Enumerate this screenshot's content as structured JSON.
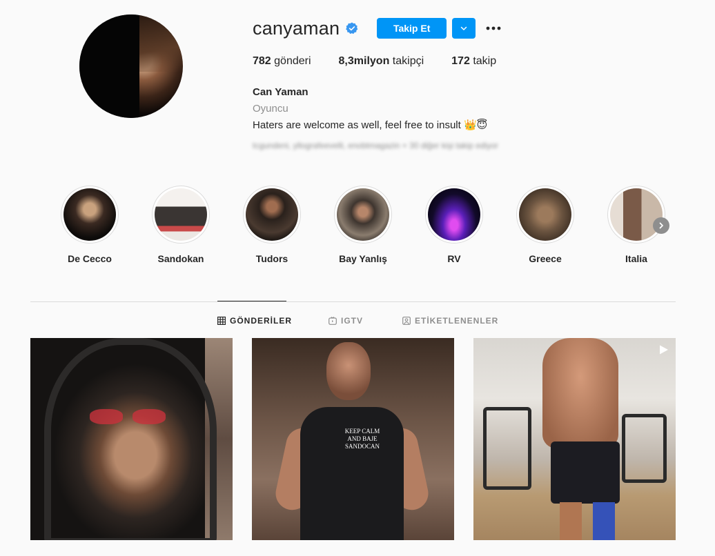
{
  "profile": {
    "username": "canyaman",
    "follow_label": "Takip Et",
    "stats": [
      {
        "value": "782",
        "label": "gönderi"
      },
      {
        "value": "8,3milyon",
        "label": "takipçi"
      },
      {
        "value": "172",
        "label": "takip"
      }
    ],
    "full_name": "Can Yaman",
    "category": "Oyuncu",
    "bio": "Haters are welcome as well, feel free to insult 👑😇",
    "followed_by_blurred": "tcgundeni, yllografeevelli, enobtmagazin + 30 diğer kişi takip ediyor"
  },
  "highlights": [
    {
      "label": "De Cecco"
    },
    {
      "label": "Sandokan"
    },
    {
      "label": "Tudors"
    },
    {
      "label": "Bay Yanlış"
    },
    {
      "label": "RV"
    },
    {
      "label": "Greece"
    },
    {
      "label": "Italia"
    }
  ],
  "tabs": [
    {
      "label": "GÖNDERİLER",
      "icon": "grid-icon",
      "active": true
    },
    {
      "label": "IGTV",
      "icon": "igtv-icon",
      "active": false
    },
    {
      "label": "ETİKETLENENLER",
      "icon": "tagged-icon",
      "active": false
    }
  ],
  "posts": [
    {
      "description": "hooded selfie with red sunglasses"
    },
    {
      "description": "gym photo, shirt text"
    },
    {
      "description": "gym video",
      "is_video": true
    }
  ],
  "post2_shirt_text": "KEEP CALM AND BAJE SANDOCAN",
  "colors": {
    "accent": "#0095f6",
    "text": "#262626",
    "secondary": "#8e8e8e",
    "background": "#fafafa",
    "verified": "#3897f0"
  }
}
